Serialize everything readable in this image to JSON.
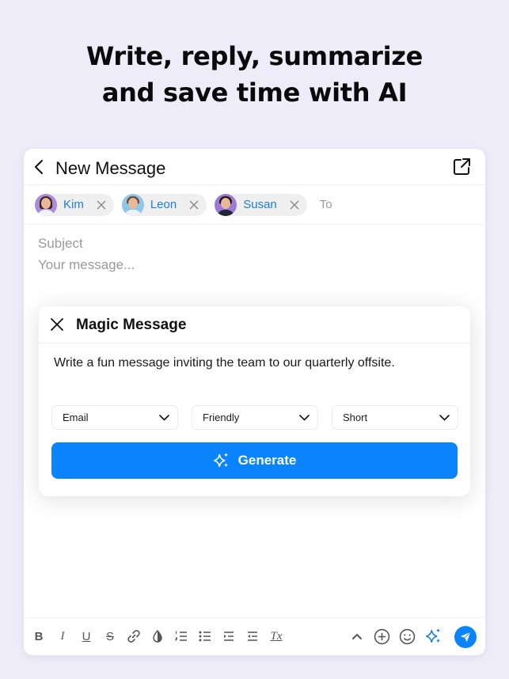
{
  "headline": {
    "line1": "Write, reply, summarize",
    "line2": "and save time with AI"
  },
  "compose": {
    "title": "New Message",
    "back_icon": "chevron-left-icon",
    "popout_icon": "open-external-icon",
    "recipients": [
      {
        "name": "Kim",
        "avatar_bg": "#a98bdb",
        "hair": "#3a2418",
        "shirt": "#f3f3f3"
      },
      {
        "name": "Leon",
        "avatar_bg": "#8fc7ea",
        "hair": "#6a4a30",
        "shirt": "#f2f2f2"
      },
      {
        "name": "Susan",
        "avatar_bg": "#9b7ad6",
        "hair": "#1b1410",
        "shirt": "#1c2636"
      }
    ],
    "to_label": "To",
    "subject_placeholder": "Subject",
    "message_placeholder": "Your message..."
  },
  "magic_message": {
    "title": "Magic Message",
    "close_icon": "close-icon",
    "prompt": "Write a fun message inviting the team to our quarterly offsite.",
    "selects": [
      {
        "name": "type",
        "value": "Email"
      },
      {
        "name": "tone",
        "value": "Friendly"
      },
      {
        "name": "length",
        "value": "Short"
      }
    ],
    "generate_label": "Generate",
    "generate_icon": "sparkles-icon"
  },
  "toolbar": {
    "bold": "B",
    "italic": "I",
    "underline": "U",
    "strikethrough": "S",
    "clear_format": "Tx",
    "icons": [
      "bold-icon",
      "italic-icon",
      "underline-icon",
      "strikethrough-icon",
      "link-icon",
      "color-icon",
      "numbered-list-icon",
      "bullet-list-icon",
      "indent-icon",
      "outdent-icon",
      "clear-format-icon",
      "chevron-up-icon",
      "add-icon",
      "emoji-icon",
      "ai-sparkles-icon",
      "send-icon"
    ]
  },
  "colors": {
    "background": "#eeecf8",
    "accent": "#0a83fb",
    "chip_text": "#1a7fe0",
    "placeholder": "#9a9a9a"
  }
}
